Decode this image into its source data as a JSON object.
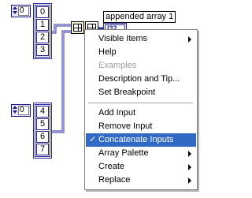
{
  "controls": [
    {
      "index": "0",
      "values": [
        "0",
        "1",
        "2",
        "3"
      ]
    },
    {
      "index": "0",
      "values": [
        "4",
        "5",
        "6",
        "7"
      ]
    }
  ],
  "output": {
    "label": "appended array 1",
    "type": "I32"
  },
  "menu": {
    "items": [
      {
        "label": "Visible Items",
        "submenu": true
      },
      {
        "label": "Help"
      },
      {
        "label": "Examples",
        "disabled": true
      },
      {
        "label": "Description and Tip..."
      },
      {
        "label": "Set Breakpoint"
      },
      {
        "label": "Add Input"
      },
      {
        "label": "Remove Input"
      },
      {
        "label": "Concatenate Inputs",
        "checked": true
      },
      {
        "label": "Array Palette",
        "submenu": true
      },
      {
        "label": "Create",
        "submenu": true
      },
      {
        "label": "Replace",
        "submenu": true
      }
    ],
    "check_glyph": "✓"
  },
  "colors": {
    "wire": "#2a2aa0",
    "menu_highlight": "#316ac5",
    "node_fill": "#f4f0d0"
  }
}
